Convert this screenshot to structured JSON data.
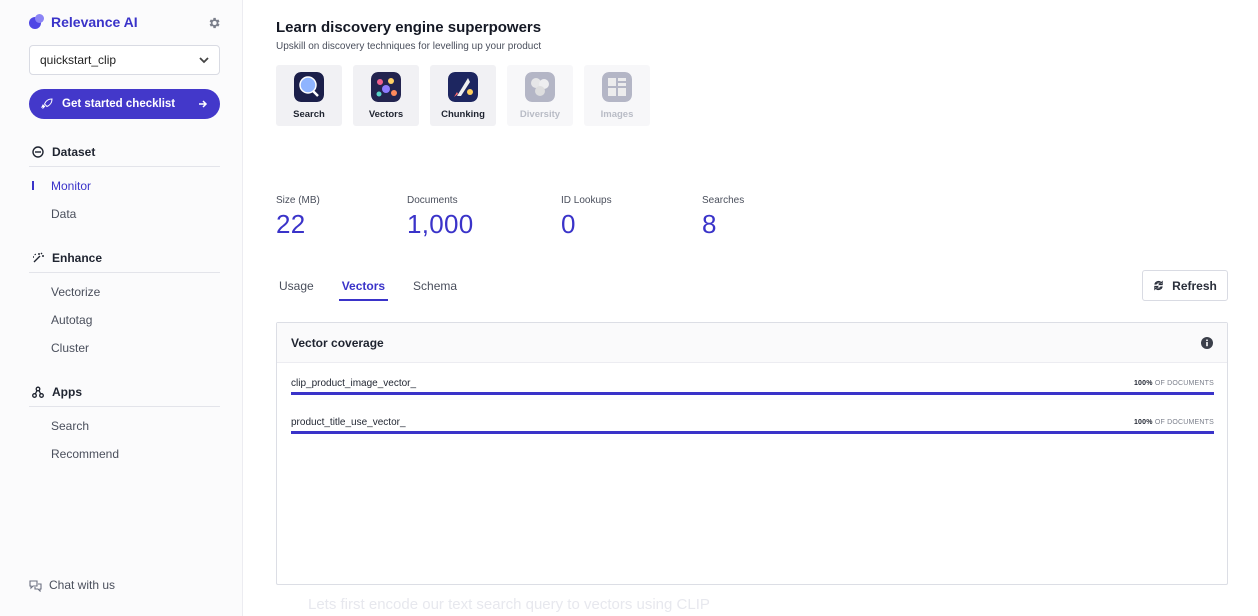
{
  "brand": {
    "name": "Relevance AI"
  },
  "dataset_select": {
    "value": "quickstart_clip"
  },
  "checklist_button": {
    "label": "Get started checklist"
  },
  "nav": {
    "dataset": {
      "label": "Dataset",
      "items": [
        "Monitor",
        "Data"
      ]
    },
    "enhance": {
      "label": "Enhance",
      "items": [
        "Vectorize",
        "Autotag",
        "Cluster"
      ]
    },
    "apps": {
      "label": "Apps",
      "items": [
        "Search",
        "Recommend"
      ]
    }
  },
  "chat": {
    "label": "Chat with us"
  },
  "header": {
    "title": "Learn discovery engine superpowers",
    "subtitle": "Upskill on discovery techniques for levelling up your product"
  },
  "topics": [
    {
      "label": "Search"
    },
    {
      "label": "Vectors"
    },
    {
      "label": "Chunking"
    },
    {
      "label": "Diversity"
    },
    {
      "label": "Images"
    }
  ],
  "stats": [
    {
      "label": "Size (MB)",
      "value": "22"
    },
    {
      "label": "Documents",
      "value": "1,000"
    },
    {
      "label": "ID Lookups",
      "value": "0"
    },
    {
      "label": "Searches",
      "value": "8"
    }
  ],
  "tabs": [
    "Usage",
    "Vectors",
    "Schema"
  ],
  "refresh": {
    "label": "Refresh"
  },
  "panel": {
    "title": "Vector coverage",
    "rows": [
      {
        "name": "clip_product_image_vector_",
        "percent_label": "100%",
        "suffix": "OF DOCUMENTS",
        "fraction": 1.0
      },
      {
        "name": "product_title_use_vector_",
        "percent_label": "100%",
        "suffix": "OF DOCUMENTS",
        "fraction": 1.0
      }
    ]
  },
  "ghost": {
    "text": "Lets first encode our text search query to vectors using CLIP"
  }
}
